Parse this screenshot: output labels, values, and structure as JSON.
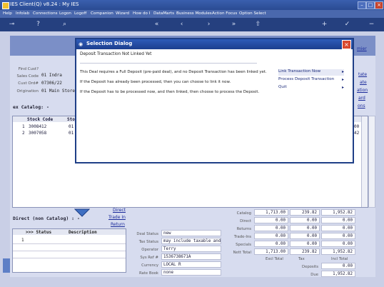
{
  "window": {
    "title": "IES Client(Q) v8.24 : My IES"
  },
  "menu": [
    "Help",
    "Infolab",
    "Connections",
    "Logon",
    "Logoff",
    "Companion",
    "Wizard",
    "How do I",
    "DataMarts",
    "Business Modules",
    "Action Focus",
    "Option Select"
  ],
  "toolbar": {
    "icons": [
      "key-icon",
      "help-icon",
      "search-icon",
      "first-icon",
      "back-icon",
      "forward-icon",
      "last-icon",
      "upload-icon",
      "add-icon",
      "confirm-icon",
      "delete-icon"
    ]
  },
  "form": {
    "labels": {
      "find_cust": "Find Cust?",
      "sales_code": "Sales Code",
      "cust_ordr": "Cust Ord#",
      "origination": "Origination"
    },
    "values": {
      "sales_code": "01 Indra",
      "cust_ordr": "07306/22",
      "origination": "01 Main Store"
    }
  },
  "section_catalog": "ex Catalog: -",
  "right_links": [
    "mier",
    "tate",
    "ate",
    "ation",
    "ard",
    "ons"
  ],
  "grid": {
    "headers": [
      "Stock Code",
      "Stor"
    ],
    "rows": [
      {
        "n": "1",
        "code": "3008412",
        "store": "01",
        "right": "00"
      },
      {
        "n": "2",
        "code": "3007058",
        "store": "01",
        "right": "42"
      }
    ]
  },
  "section_direct": "Direct (non Catalog) : -",
  "direct_links": [
    "Direct",
    "Trade In",
    "Return"
  ],
  "sub_grid": {
    "headers": [
      ">>> Status",
      "Description"
    ],
    "rows": [
      "1"
    ]
  },
  "deal": [
    {
      "label": "Deal Status",
      "value": "new"
    },
    {
      "label": "Tax Status",
      "value": "may include taxable and"
    },
    {
      "label": "Operator",
      "value": "Terry"
    },
    {
      "label": "Sys Ref #",
      "value": "1536738671A"
    },
    {
      "label": "Currency",
      "value": "LOCAL R"
    },
    {
      "label": "Rate Book",
      "value": "none"
    }
  ],
  "totals": [
    {
      "label": "Catalog",
      "a": "1,713.00",
      "b": "239.82",
      "c": "1,952.82"
    },
    {
      "label": "Direct",
      "a": "0.00",
      "b": "0.00",
      "c": "0.00"
    },
    {
      "label": "Returns",
      "a": "0.00",
      "b": "0.00",
      "c": "0.00"
    },
    {
      "label": "Trade-Ins",
      "a": "0.00",
      "b": "0.00",
      "c": "0.00"
    },
    {
      "label": "Specials",
      "a": "0.00",
      "b": "0.00",
      "c": "0.00"
    },
    {
      "label": "Nett Total",
      "a": "1,713.00",
      "b": "239.82",
      "c": "1,952.82"
    }
  ],
  "totals_footer": {
    "excl": "Excl Total",
    "tax": "Tax",
    "incl": "Incl Total",
    "deposits_label": "Deposits",
    "deposits_value": "0.00",
    "due_label": "Due",
    "due_value": "1,952.82"
  },
  "dialog": {
    "title": "Selection Dialog",
    "heading": "Deposit Transaction Not Linked Yet",
    "lines": [
      "This Deal requires a Full Deposit (pre-paid deal), and no Deposit Transaction has been linked yet.",
      "If the Deposit has already been processed, then you can choose to link it now.",
      "If the Deposit has to be processed now, and then linked, then choose to process the Deposit."
    ],
    "options": [
      "Link Transaction Now",
      "Process Deposit Transaction",
      "Quit"
    ]
  }
}
